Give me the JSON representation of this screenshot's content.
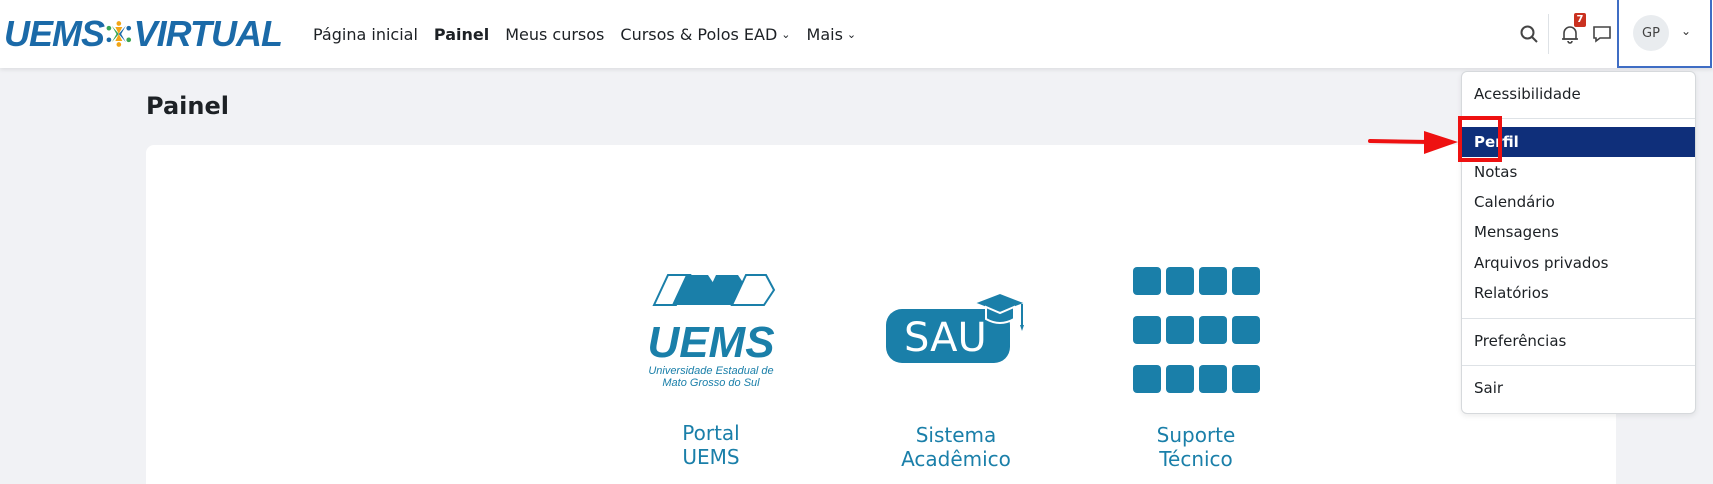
{
  "brand": {
    "left": "UEMS",
    "right": "VIRTUAL"
  },
  "nav": {
    "links": [
      {
        "label": "Página inicial",
        "active": false,
        "dropdown": false
      },
      {
        "label": "Painel",
        "active": true,
        "dropdown": false
      },
      {
        "label": "Meus cursos",
        "active": false,
        "dropdown": false
      },
      {
        "label": "Cursos & Polos EAD",
        "active": false,
        "dropdown": true
      },
      {
        "label": "Mais",
        "active": false,
        "dropdown": true
      }
    ],
    "notification_count": "7",
    "user_initials": "GP"
  },
  "page": {
    "title": "Painel"
  },
  "tiles": [
    {
      "line1": "Portal",
      "line2": "UEMS",
      "logo_text": "UEMS",
      "logo_sub1": "Universidade Estadual de",
      "logo_sub2": "Mato Grosso do Sul"
    },
    {
      "line1": "Sistema",
      "line2": "Acadêmico",
      "logo_text": "SAU"
    },
    {
      "line1": "Suporte",
      "line2": "Técnico"
    }
  ],
  "user_menu": {
    "items": [
      {
        "label": "Acessibilidade"
      },
      {
        "label": "Perfil",
        "selected": true
      },
      {
        "label": "Notas"
      },
      {
        "label": "Calendário"
      },
      {
        "label": "Mensagens"
      },
      {
        "label": "Arquivos privados"
      },
      {
        "label": "Relatórios"
      },
      {
        "label": "Preferências"
      },
      {
        "label": "Sair"
      }
    ]
  },
  "colors": {
    "brand_blue": "#1b6aa8",
    "tile_blue": "#1a7fa9",
    "menu_selected": "#0f2f7a",
    "annotation_red": "#ee1111"
  },
  "icons": [
    "search-icon",
    "bell-icon",
    "chat-icon",
    "chevron-down-icon",
    "graduation-cap-icon"
  ]
}
